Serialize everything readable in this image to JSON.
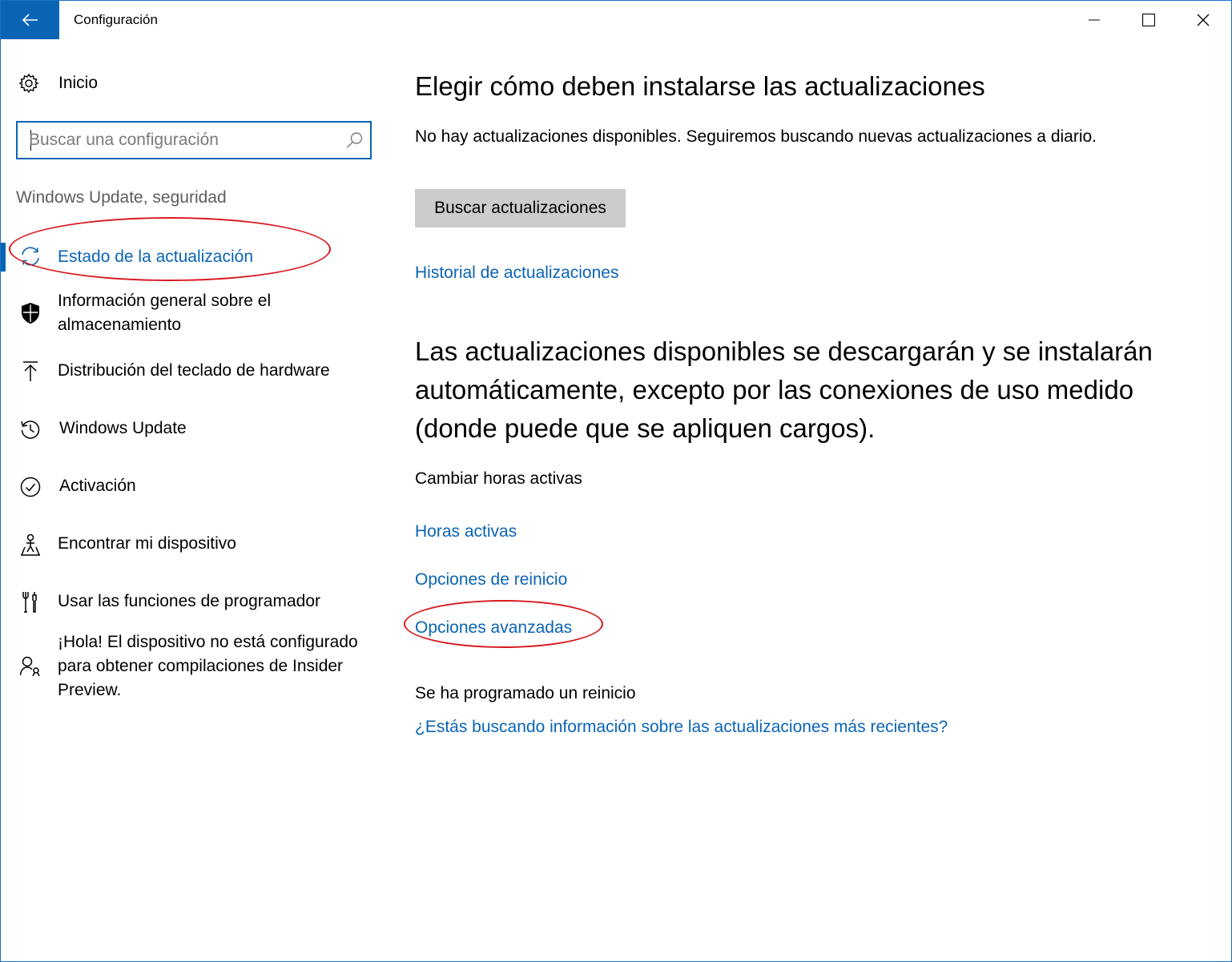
{
  "window": {
    "title": "Configuración",
    "accent_color": "#0a64b4",
    "annotation_color": "#d8191f"
  },
  "sidebar": {
    "home_label": "Inicio",
    "search_placeholder": "Buscar una configuración",
    "section_title": "Windows Update, seguridad",
    "items": [
      {
        "label": "Estado de la actualización",
        "icon": "refresh-icon",
        "active": true
      },
      {
        "label": "Información general sobre el almacenamiento",
        "icon": "shield-icon"
      },
      {
        "label": "Distribución del teclado de hardware",
        "icon": "upload-arrow-icon"
      },
      {
        "label": "Windows Update",
        "icon": "history-icon"
      },
      {
        "label": "Activación",
        "icon": "check-circle-icon"
      },
      {
        "label": "Encontrar mi dispositivo",
        "icon": "person-location-icon"
      },
      {
        "label": "Usar las funciones de programador",
        "icon": "developer-tools-icon"
      },
      {
        "label": "¡Hola! El dispositivo no está configurado para obtener compilaciones de Insider Preview.",
        "icon": "insider-person-icon"
      }
    ]
  },
  "main": {
    "title": "Elegir cómo deben instalarse las actualizaciones",
    "status_text": "No hay actualizaciones disponibles. Seguiremos buscando nuevas actualizaciones a diario.",
    "check_button_label": "Buscar actualizaciones",
    "history_link": "Historial de actualizaciones",
    "auto_text": "Las actualizaciones disponibles se descargarán y se instalarán automáticamente, excepto por las conexiones de uso medido (donde puede que se apliquen cargos).",
    "active_hours_heading": "Cambiar horas activas",
    "active_hours_link": "Horas activas",
    "restart_options_link": "Opciones de reinicio",
    "advanced_options_link": "Opciones avanzadas",
    "restart_scheduled_text": "Se ha programado un reinicio",
    "latest_info_link": "¿Estás buscando información sobre las actualizaciones más recientes?"
  }
}
